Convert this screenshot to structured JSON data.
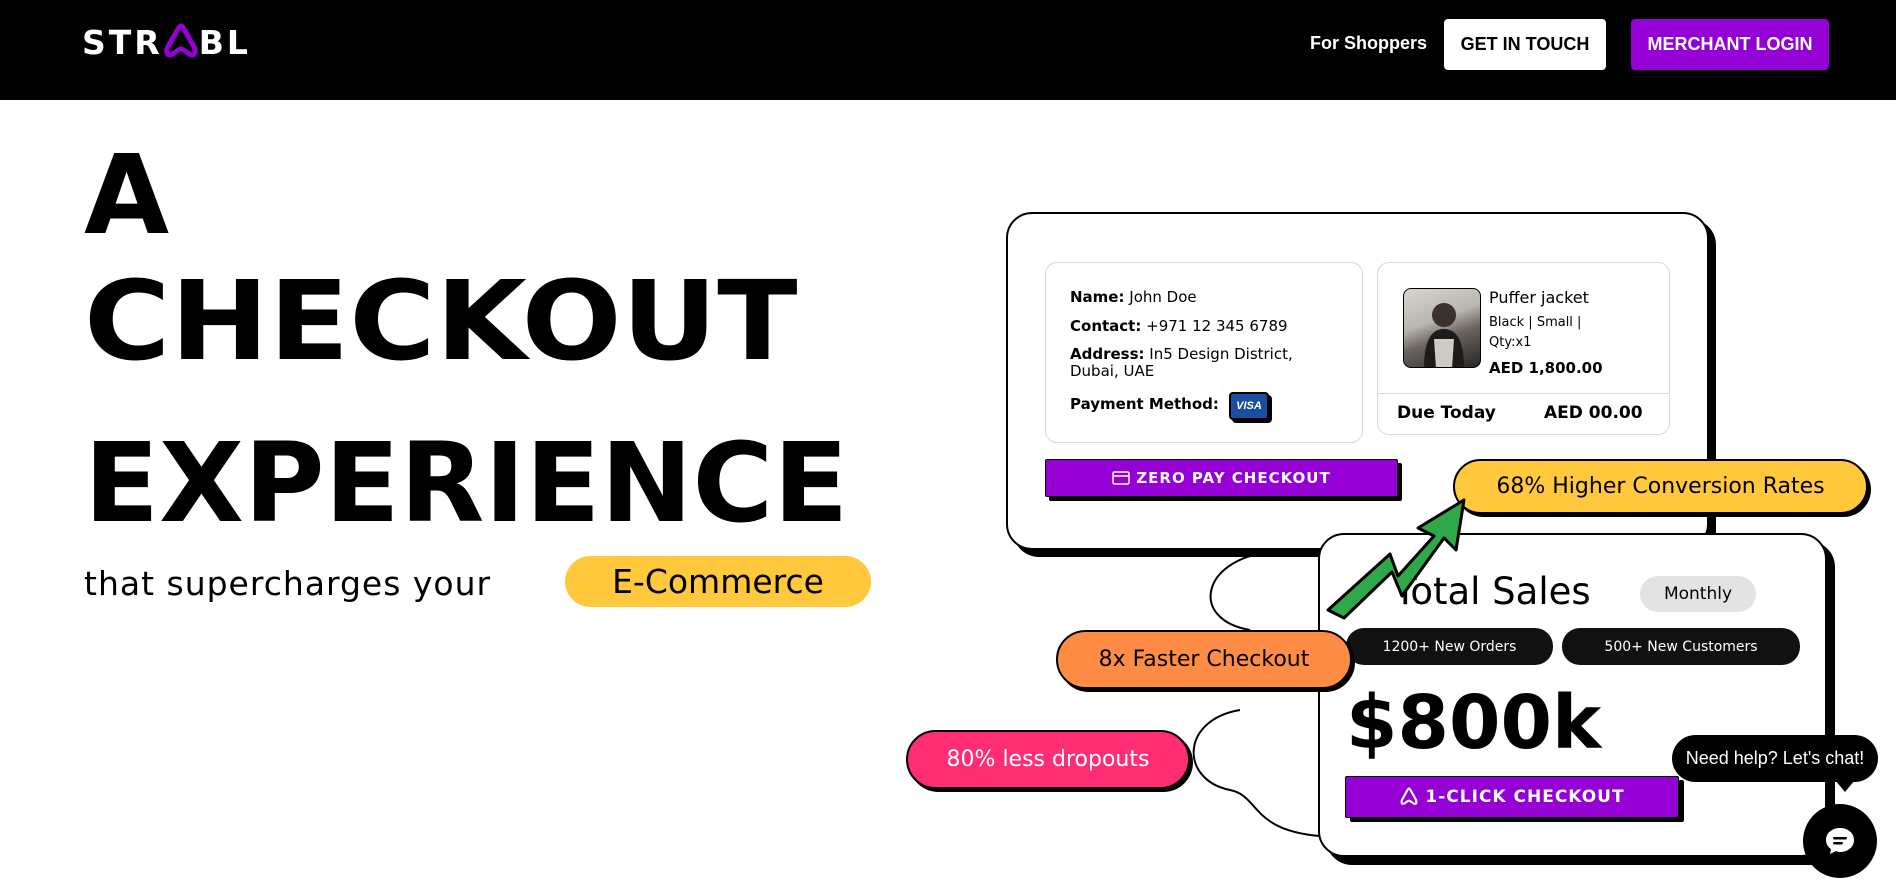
{
  "nav": {
    "logo_before": "STR",
    "logo_after": "BL",
    "logo_accent_color": "#9500d4",
    "link_shoppers": "For Shoppers",
    "btn_touch": "GET IN TOUCH",
    "btn_merchant": "MERCHANT LOGIN"
  },
  "hero": {
    "line1": "A",
    "line2": "CHECKOUT",
    "line3": "EXPERIENCE",
    "subtitle": "that supercharges your",
    "highlight": "E-Commerce",
    "highlight_color": "#ffc83d"
  },
  "checkout_card": {
    "name_label": "Name:",
    "name_value": "John Doe",
    "contact_label": "Contact:",
    "contact_value": "+971 12 345 6789",
    "address_label": "Address:",
    "address_value_1": "In5 Design District,",
    "address_value_2": "Dubai, UAE",
    "payment_label": "Payment Method:",
    "visa": "VISA",
    "product_title": "Puffer jacket",
    "product_meta_1": "Black | Small |",
    "product_meta_2": "Qty:x1",
    "product_price": "AED 1,800.00",
    "due_label": "Due Today",
    "due_value": "AED 00.00",
    "zero_pay": "ZERO PAY CHECKOUT"
  },
  "sales_card": {
    "title": "Total Sales",
    "period": "Monthly",
    "chip_orders": "1200+ New Orders",
    "chip_customers": "500+ New Customers",
    "big_value": "$800k",
    "one_click": "1-CLICK CHECKOUT"
  },
  "badges": {
    "conversion": "68% Higher Conversion Rates",
    "faster": "8x Faster Checkout",
    "dropouts": "80% less dropouts",
    "colors": {
      "conversion": "#ffc83d",
      "faster": "#ff8c45",
      "dropouts": "#ff2e73",
      "arrow": "#2ea84a"
    }
  },
  "chat": {
    "bubble": "Need help? Let's chat!",
    "icon": "chat-icon"
  }
}
